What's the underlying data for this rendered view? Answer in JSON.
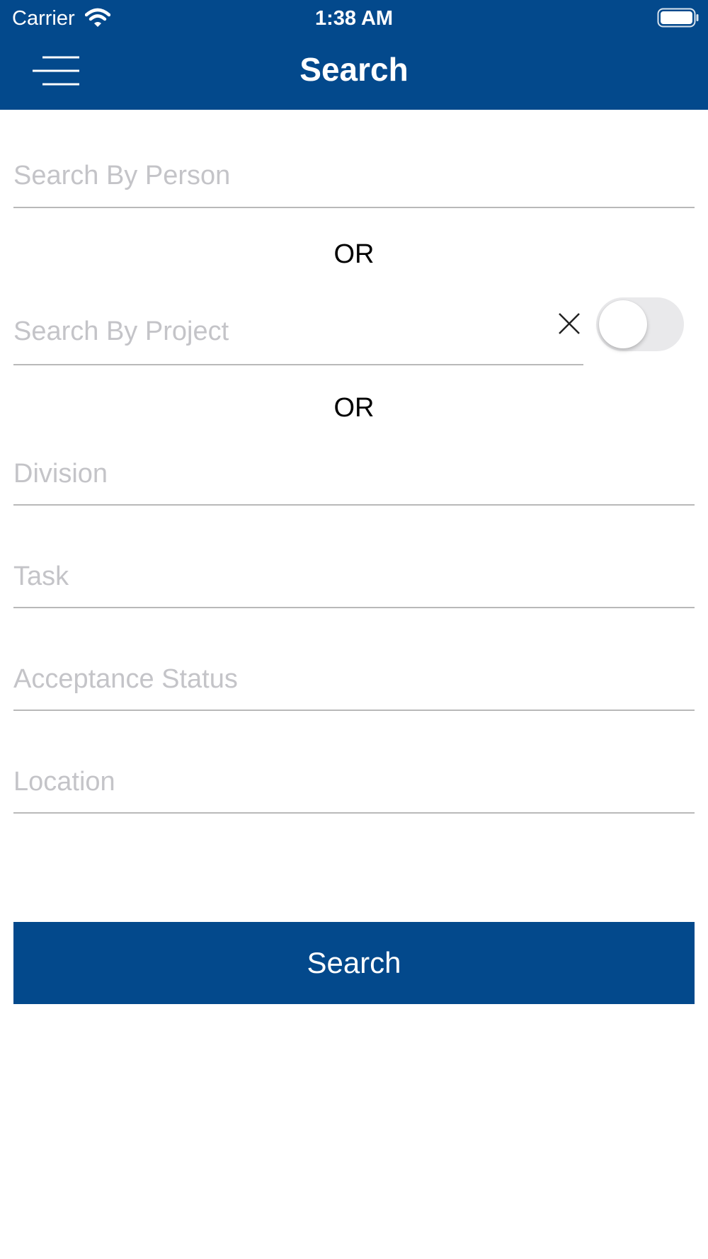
{
  "status_bar": {
    "carrier": "Carrier",
    "time": "1:38 AM"
  },
  "header": {
    "title": "Search",
    "background": "#03498c"
  },
  "form": {
    "person_placeholder": "Search By Person",
    "or_1": "OR",
    "project_placeholder": "Search By Project",
    "project_toggle_on": false,
    "or_2": "OR",
    "division_placeholder": "Division",
    "task_placeholder": "Task",
    "acceptance_status_placeholder": "Acceptance Status",
    "location_placeholder": "Location"
  },
  "actions": {
    "search_label": "Search"
  },
  "icons": {
    "menu": "hamburger-menu-icon",
    "clear": "close-icon",
    "wifi": "wifi-icon",
    "battery": "battery-icon"
  }
}
